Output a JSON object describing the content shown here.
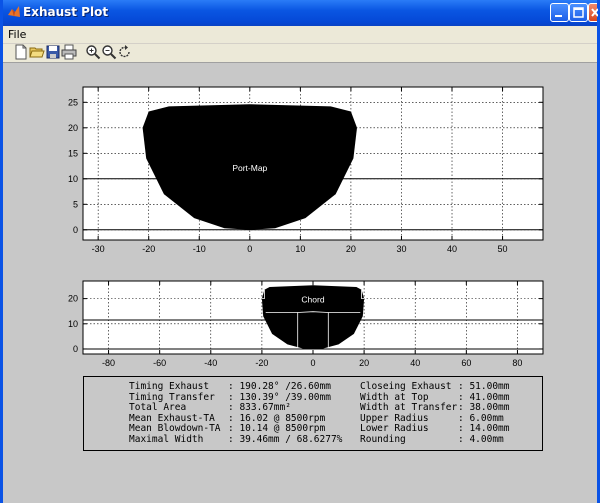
{
  "window": {
    "title": "Exhaust Plot",
    "controls": [
      "minimize",
      "maximize",
      "close"
    ]
  },
  "menu": {
    "items": [
      "File"
    ]
  },
  "toolbar": {
    "icons": [
      "new-icon",
      "open-icon",
      "save-icon",
      "print-icon",
      "zoom-in-icon",
      "zoom-out-icon",
      "rotate-icon"
    ]
  },
  "chart_data": [
    {
      "type": "area",
      "name": "port-map",
      "annotation": "Port-Map",
      "xlim": [
        -33,
        58
      ],
      "ylim": [
        -2,
        28
      ],
      "xticks": [
        -30,
        -20,
        -10,
        0,
        10,
        20,
        30,
        40,
        50
      ],
      "yticks": [
        0,
        5,
        10,
        15,
        20,
        25
      ],
      "grid": true,
      "hlines": [
        0,
        10
      ],
      "outline": [
        [
          -21.2,
          20
        ],
        [
          -20,
          23.2
        ],
        [
          -16,
          24.2
        ],
        [
          0,
          24.6
        ],
        [
          16,
          24.2
        ],
        [
          20,
          23.2
        ],
        [
          21.2,
          20
        ],
        [
          20.5,
          14
        ],
        [
          17,
          7
        ],
        [
          11,
          2.3
        ],
        [
          5,
          0.3
        ],
        [
          0,
          0
        ],
        [
          -5,
          0.3
        ],
        [
          -11,
          2.3
        ],
        [
          -17,
          7
        ],
        [
          -20.5,
          14
        ]
      ]
    },
    {
      "type": "area",
      "name": "chord",
      "annotation": "Chord",
      "xlim": [
        -90,
        90
      ],
      "ylim": [
        -2,
        27
      ],
      "xticks": [
        -80,
        -60,
        -40,
        -20,
        0,
        20,
        40,
        60,
        80
      ],
      "yticks": [
        0,
        10,
        20
      ],
      "grid": true,
      "hlines": [
        0,
        11.5
      ],
      "outline": [
        [
          -20,
          20
        ],
        [
          -19,
          23.5
        ],
        [
          -17,
          24.6
        ],
        [
          0,
          25.3
        ],
        [
          17,
          24.6
        ],
        [
          19,
          23.5
        ],
        [
          20,
          20
        ],
        [
          19.5,
          13
        ],
        [
          16,
          6
        ],
        [
          10,
          1.8
        ],
        [
          4,
          0.2
        ],
        [
          0,
          0
        ],
        [
          -4,
          0.2
        ],
        [
          -10,
          1.8
        ],
        [
          -16,
          6
        ],
        [
          -19.5,
          13
        ]
      ],
      "inner_lines": [
        [
          [
            -20,
            20
          ],
          [
            -19,
            20
          ],
          [
            -19,
            23.5
          ]
        ],
        [
          [
            20,
            20
          ],
          [
            19,
            20
          ],
          [
            19,
            23.5
          ]
        ],
        [
          [
            -18.5,
            14.5
          ],
          [
            -6,
            14.5
          ],
          [
            -6,
            0.2
          ]
        ],
        [
          [
            -6,
            14.5
          ],
          [
            0,
            14.8
          ],
          [
            6,
            14.5
          ]
        ],
        [
          [
            18.5,
            14.5
          ],
          [
            6,
            14.5
          ],
          [
            6,
            0.2
          ]
        ]
      ]
    }
  ],
  "info": {
    "left_labels": [
      "Timing Exhaust",
      "Timing Transfer",
      "Total Area",
      "Mean Exhaust-TA",
      "Mean Blowdown-TA",
      "Maximal Width"
    ],
    "left_values": [
      ": 190.28° /26.60mm",
      ": 130.39° /39.00mm",
      ": 833.67mm²",
      ": 16.02 @ 8500rpm",
      ": 10.14 @ 8500rpm",
      ": 39.46mm / 68.6277%"
    ],
    "right_labels": [
      "Closeing Exhaust",
      "Width at Top",
      "Width at Transfer",
      "Upper Radius",
      "Lower Radius",
      "Rounding"
    ],
    "right_values": [
      ": 51.00mm",
      ": 41.00mm",
      ": 38.00mm",
      ": 6.00mm",
      ": 14.00mm",
      ": 4.00mm"
    ]
  }
}
